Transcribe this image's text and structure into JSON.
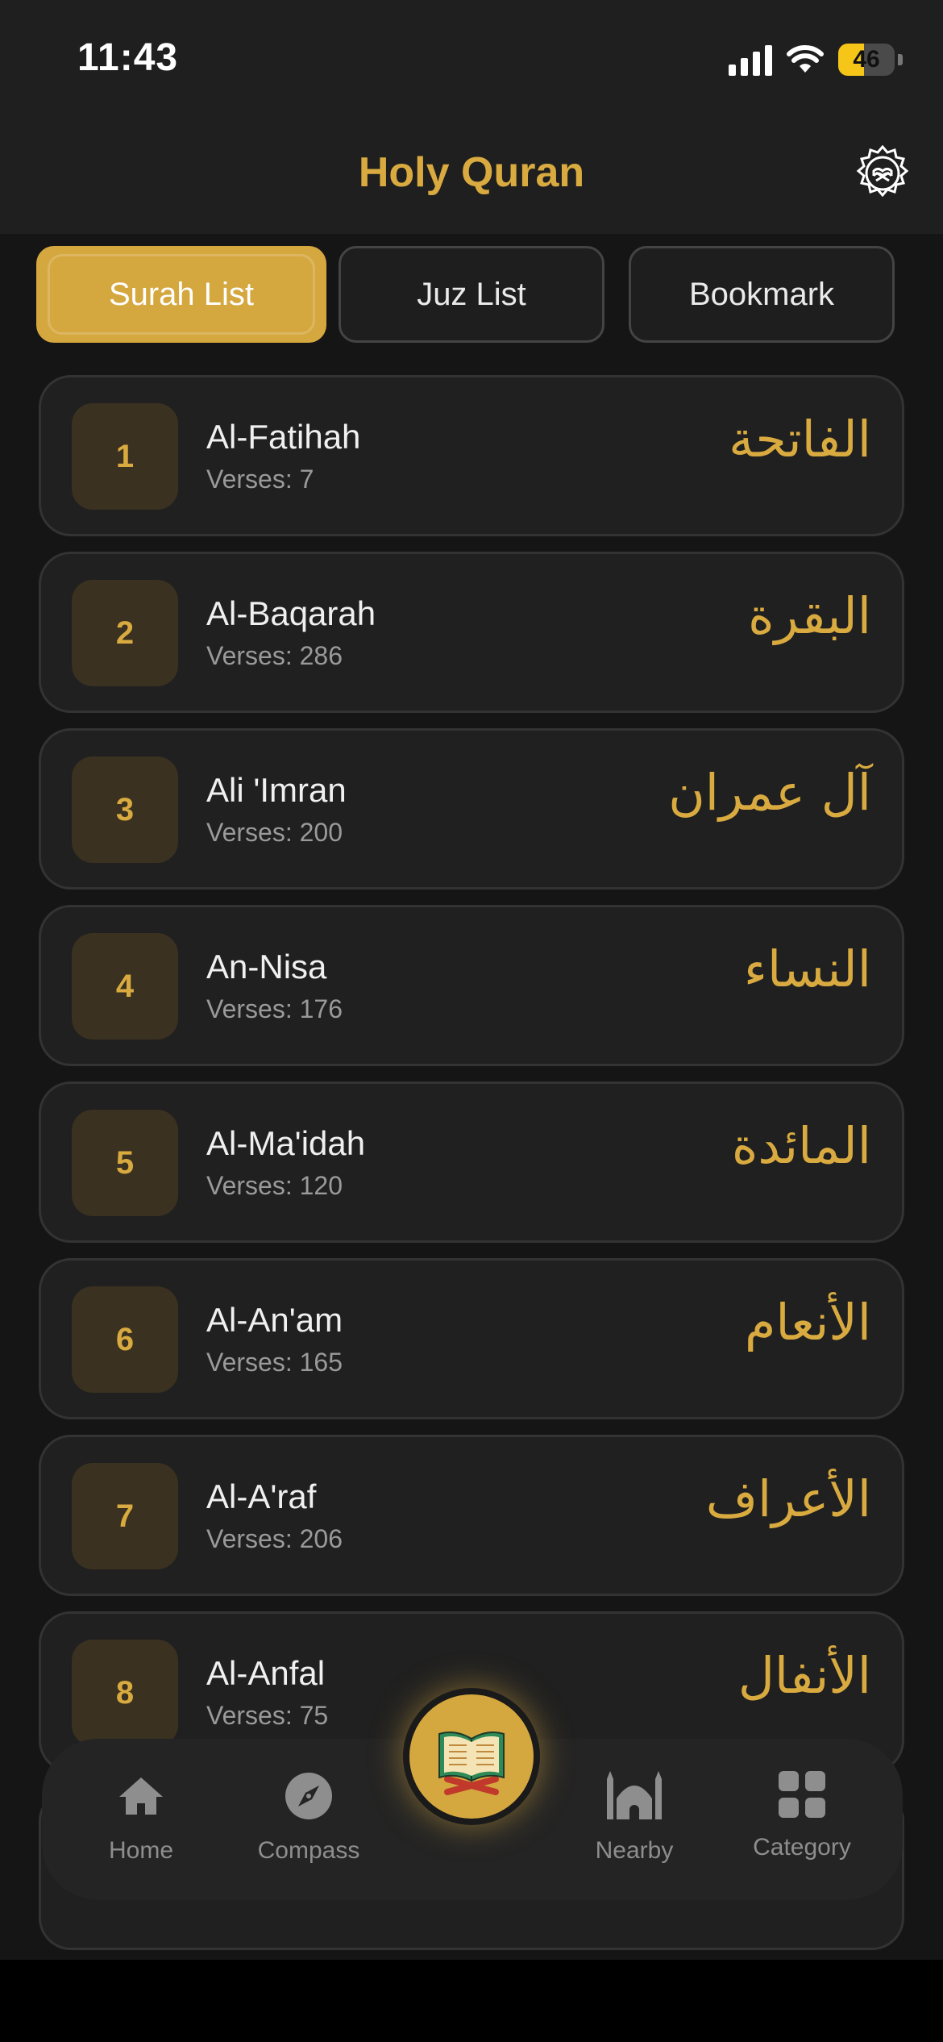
{
  "status_bar": {
    "time": "11:43",
    "battery": "46",
    "battery_level": 0.46
  },
  "header": {
    "title": "Holy Quran",
    "settings_icon": "gear-quran-icon"
  },
  "tabs": [
    {
      "label": "Surah List",
      "active": true
    },
    {
      "label": "Juz List",
      "active": false
    },
    {
      "label": "Bookmark",
      "active": false
    }
  ],
  "surahs": [
    {
      "number": "1",
      "name": "Al-Fatihah",
      "verses": "Verses: 7",
      "arabic": "الفاتحة"
    },
    {
      "number": "2",
      "name": "Al-Baqarah",
      "verses": "Verses: 286",
      "arabic": "البقرة"
    },
    {
      "number": "3",
      "name": "Ali 'Imran",
      "verses": "Verses: 200",
      "arabic": "آل عمران"
    },
    {
      "number": "4",
      "name": "An-Nisa",
      "verses": "Verses: 176",
      "arabic": "النساء"
    },
    {
      "number": "5",
      "name": "Al-Ma'idah",
      "verses": "Verses: 120",
      "arabic": "المائدة"
    },
    {
      "number": "6",
      "name": "Al-An'am",
      "verses": "Verses: 165",
      "arabic": "الأنعام"
    },
    {
      "number": "7",
      "name": "Al-A'raf",
      "verses": "Verses: 206",
      "arabic": "الأعراف"
    },
    {
      "number": "8",
      "name": "Al-Anfal",
      "verses": "Verses: 75",
      "arabic": "الأنفال"
    }
  ],
  "bottom_nav": [
    {
      "label": "Home",
      "icon": "home-icon"
    },
    {
      "label": "Compass",
      "icon": "compass-icon"
    },
    {
      "label": "Nearby",
      "icon": "mosque-icon"
    },
    {
      "label": "Category",
      "icon": "grid-icon"
    }
  ],
  "center_button": {
    "icon": "quran-book-icon"
  },
  "colors": {
    "accent": "#d5a73f",
    "background": "#151515",
    "card": "#202020"
  }
}
